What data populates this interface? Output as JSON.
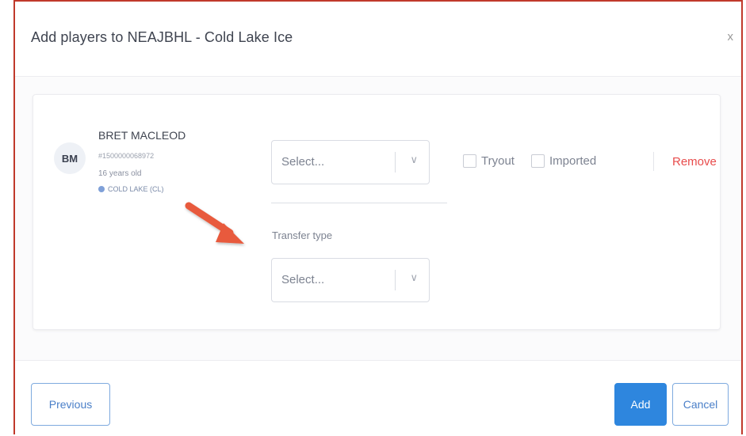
{
  "modal": {
    "title": "Add players to NEAJBHL - Cold Lake Ice",
    "close_label": "x"
  },
  "player": {
    "initials": "BM",
    "name": "BRET MACLEOD",
    "id": "#1500000068972",
    "age": "16 years old",
    "club": "COLD LAKE (CL)"
  },
  "form": {
    "select_1_placeholder": "Select...",
    "transfer_type_label": "Transfer type",
    "select_2_placeholder": "Select...",
    "tryout_label": "Tryout",
    "imported_label": "Imported",
    "remove_label": "Remove"
  },
  "footer": {
    "previous_label": "Previous",
    "add_label": "Add",
    "cancel_label": "Cancel"
  },
  "colors": {
    "annotation_arrow": "#e85a3c",
    "primary": "#2e86de",
    "danger": "#e84c4c",
    "frame_border": "#c0392b"
  }
}
